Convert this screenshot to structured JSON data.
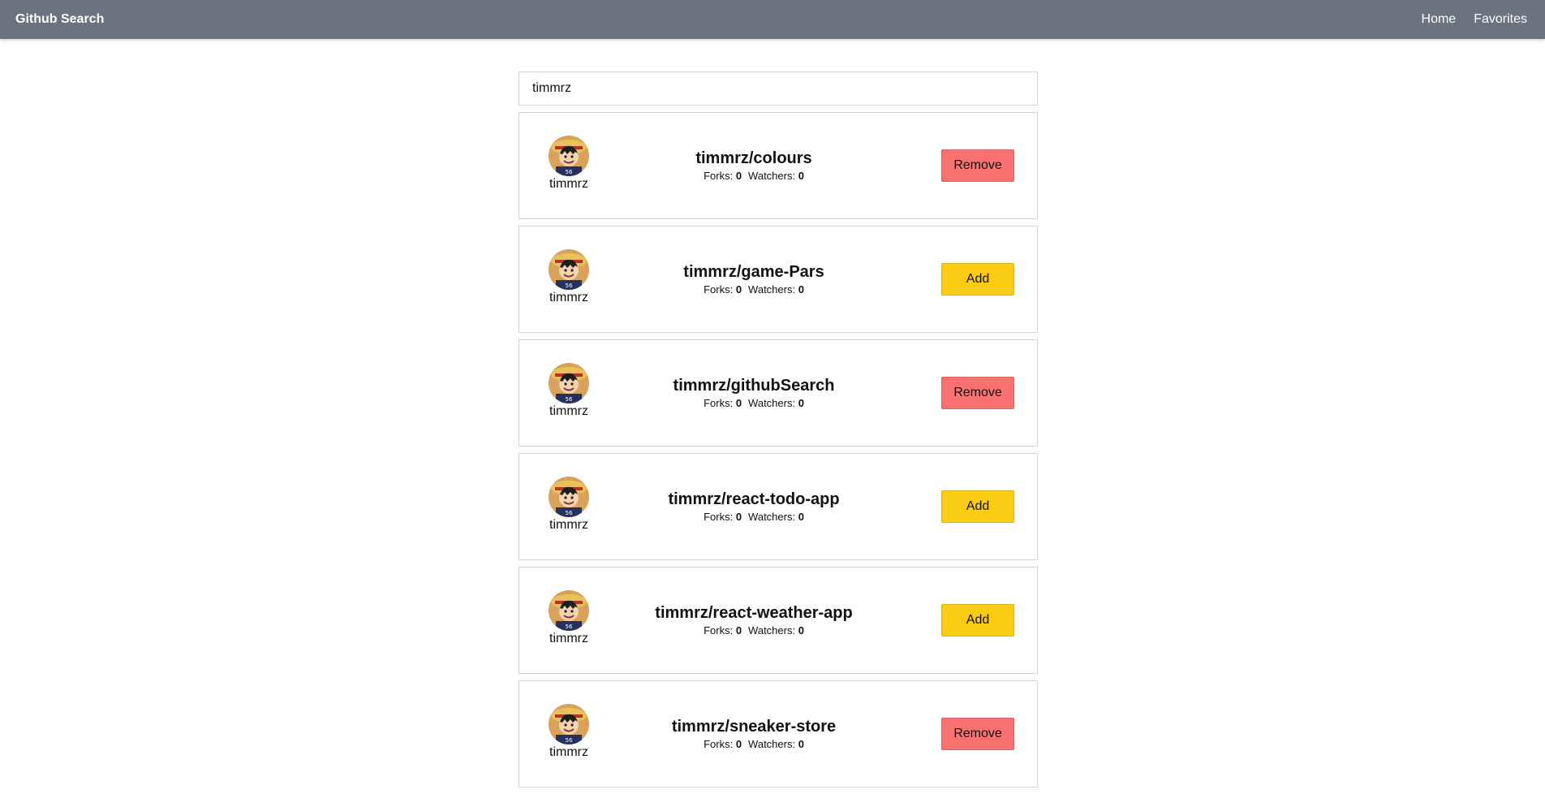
{
  "nav": {
    "brand": "Github Search",
    "links": [
      {
        "label": "Home"
      },
      {
        "label": "Favorites"
      }
    ]
  },
  "search": {
    "value": "timmrz",
    "placeholder": ""
  },
  "stats_labels": {
    "forks": "Forks:",
    "watchers": "Watchers:"
  },
  "repos": [
    {
      "owner": "timmrz",
      "name": "timmrz/colours",
      "forks": "0",
      "watchers": "0",
      "action": "Remove",
      "action_type": "remove"
    },
    {
      "owner": "timmrz",
      "name": "timmrz/game-Pars",
      "forks": "0",
      "watchers": "0",
      "action": "Add",
      "action_type": "add"
    },
    {
      "owner": "timmrz",
      "name": "timmrz/githubSearch",
      "forks": "0",
      "watchers": "0",
      "action": "Remove",
      "action_type": "remove"
    },
    {
      "owner": "timmrz",
      "name": "timmrz/react-todo-app",
      "forks": "0",
      "watchers": "0",
      "action": "Add",
      "action_type": "add"
    },
    {
      "owner": "timmrz",
      "name": "timmrz/react-weather-app",
      "forks": "0",
      "watchers": "0",
      "action": "Add",
      "action_type": "add"
    },
    {
      "owner": "timmrz",
      "name": "timmrz/sneaker-store",
      "forks": "0",
      "watchers": "0",
      "action": "Remove",
      "action_type": "remove"
    }
  ],
  "colors": {
    "navbar": "#6b7280",
    "remove_button": "#f87171",
    "add_button": "#facc15"
  },
  "icons": {
    "avatar": "avatar-icon"
  }
}
